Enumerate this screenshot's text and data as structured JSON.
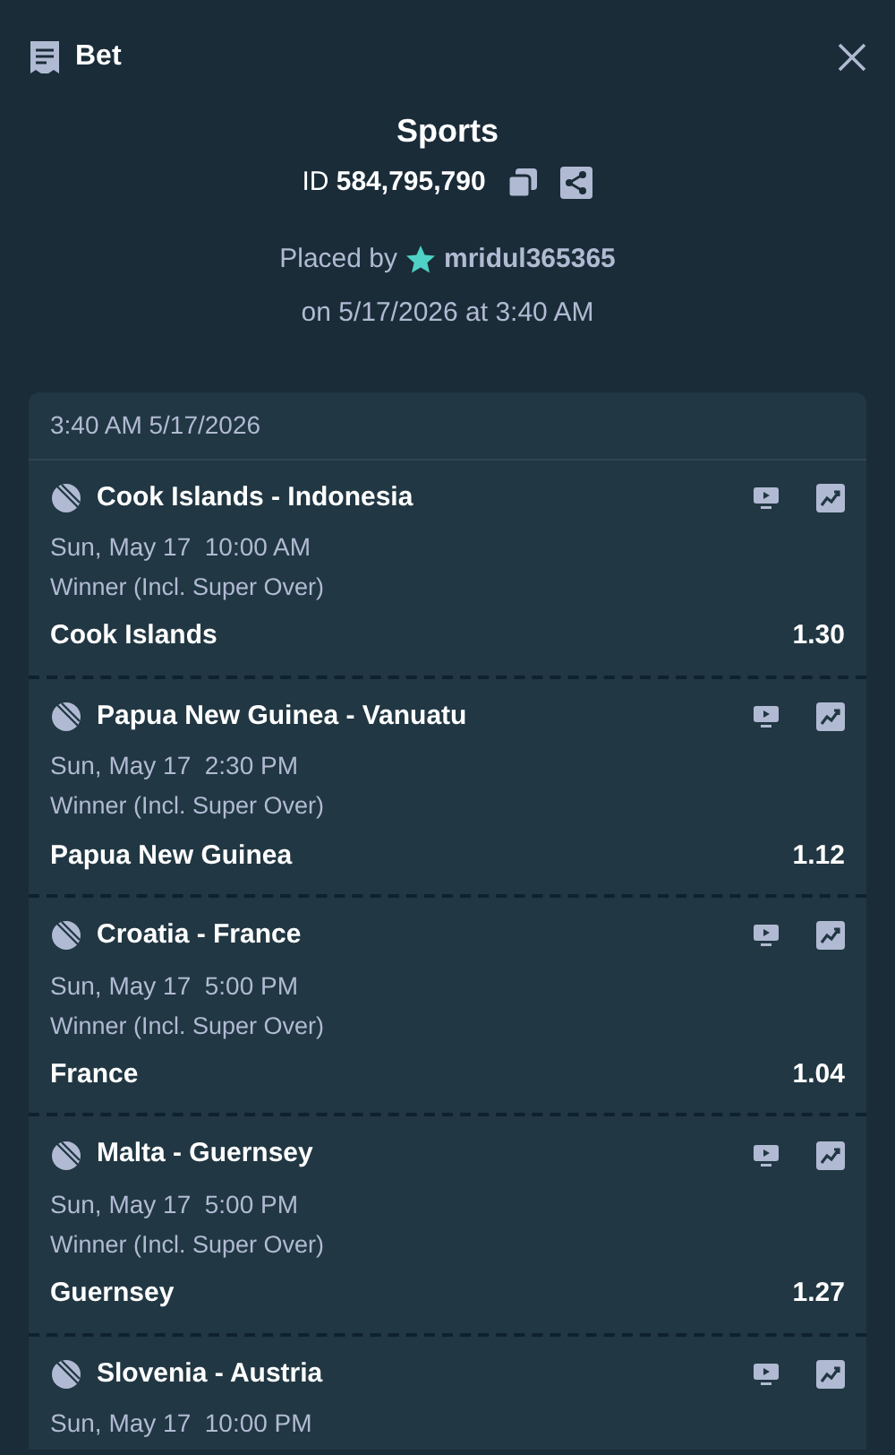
{
  "header": {
    "title": "Bet"
  },
  "summary": {
    "title": "Sports",
    "id_label": "ID",
    "id_value": "584,795,790",
    "placed_by": "Placed by",
    "user": "mridul365365",
    "placed_on": "on 5/17/2026 at 3:40 AM"
  },
  "slip": {
    "timestamp": "3:40 AM 5/17/2026",
    "legs": [
      {
        "event": "Cook Islands - Indonesia",
        "start": "Sun, May 17  10:00 AM",
        "market": "Winner (Incl. Super Over)",
        "selection": "Cook Islands",
        "odds": "1.30"
      },
      {
        "event": "Papua New Guinea - Vanuatu",
        "start": "Sun, May 17  2:30 PM",
        "market": "Winner (Incl. Super Over)",
        "selection": "Papua New Guinea",
        "odds": "1.12"
      },
      {
        "event": "Croatia - France",
        "start": "Sun, May 17  5:00 PM",
        "market": "Winner (Incl. Super Over)",
        "selection": "France",
        "odds": "1.04"
      },
      {
        "event": "Malta - Guernsey",
        "start": "Sun, May 17  5:00 PM",
        "market": "Winner (Incl. Super Over)",
        "selection": "Guernsey",
        "odds": "1.27"
      },
      {
        "event": "Slovenia - Austria",
        "start": "Sun, May 17  10:00 PM"
      }
    ]
  }
}
